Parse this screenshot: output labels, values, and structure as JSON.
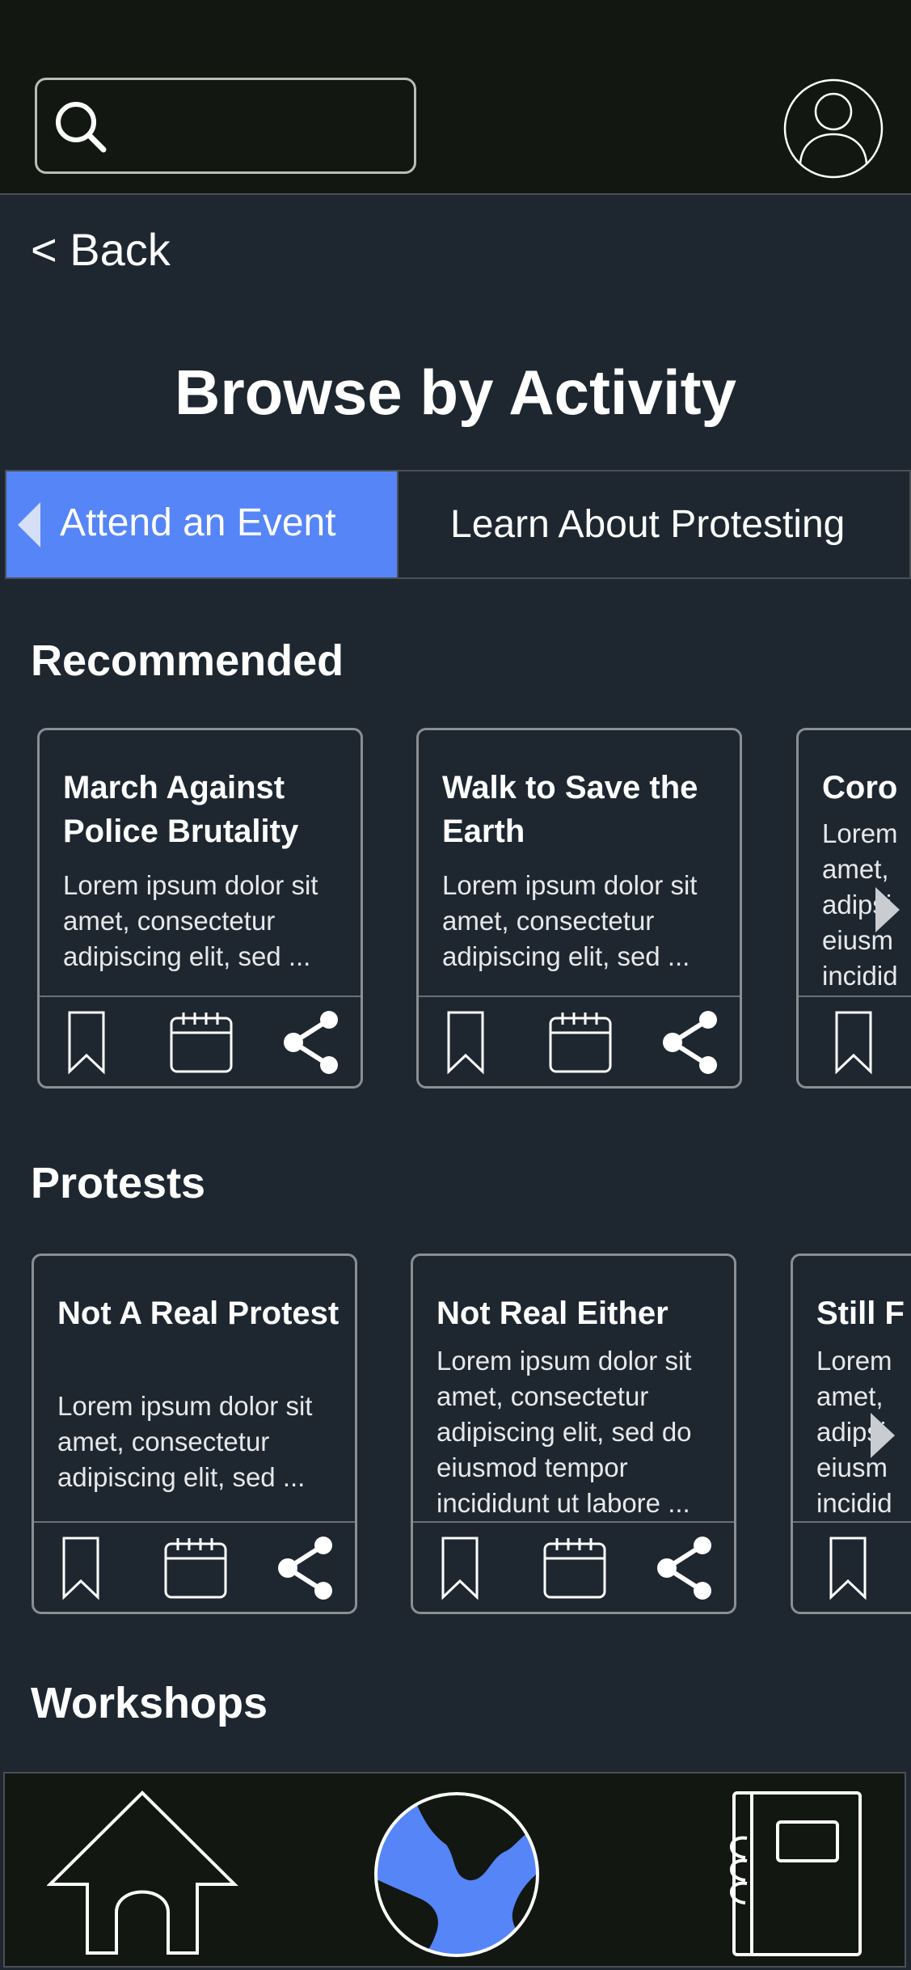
{
  "header": {
    "search_placeholder": "",
    "search_value": ""
  },
  "back_label": "< Back",
  "page_title": "Browse by Activity",
  "tabs": [
    {
      "label": "Attend an Event",
      "active": true
    },
    {
      "label": "Learn About Protesting",
      "active": false
    }
  ],
  "sections": {
    "recommended": {
      "heading": "Recommended",
      "cards": [
        {
          "title": "March Against Police Brutality",
          "description": "Lorem ipsum dolor sit amet, consectetur adipiscing elit, sed ..."
        },
        {
          "title": "Walk to Save the Earth",
          "description": "Lorem ipsum dolor sit amet, consectetur adipiscing elit, sed ..."
        },
        {
          "title": "Coro",
          "description": "Lorem amet, adipsi eiusm incidid"
        }
      ]
    },
    "protests": {
      "heading": "Protests",
      "cards": [
        {
          "title": "Not A Real Protest",
          "description": "Lorem ipsum dolor sit amet, consectetur adipiscing elit, sed ..."
        },
        {
          "title": "Not Real Either",
          "description": "Lorem ipsum dolor sit amet, consectetur adipiscing elit, sed do eiusmod tempor incididunt ut labore ..."
        },
        {
          "title": "Still F",
          "description": "Lorem amet, adipsi eiusm incidid"
        }
      ]
    },
    "workshops": {
      "heading": "Workshops"
    }
  },
  "icons": {
    "search": "search-icon",
    "profile": "user-profile-icon",
    "bookmark": "bookmark-icon",
    "calendar": "calendar-icon",
    "share": "share-icon",
    "home": "home-icon",
    "globe": "globe-icon",
    "notebook": "notebook-icon",
    "next": "chevron-right-icon",
    "prev": "chevron-left-icon"
  },
  "colors": {
    "accent": "#5585f7",
    "background": "#1e2730",
    "bar": "#131712"
  }
}
